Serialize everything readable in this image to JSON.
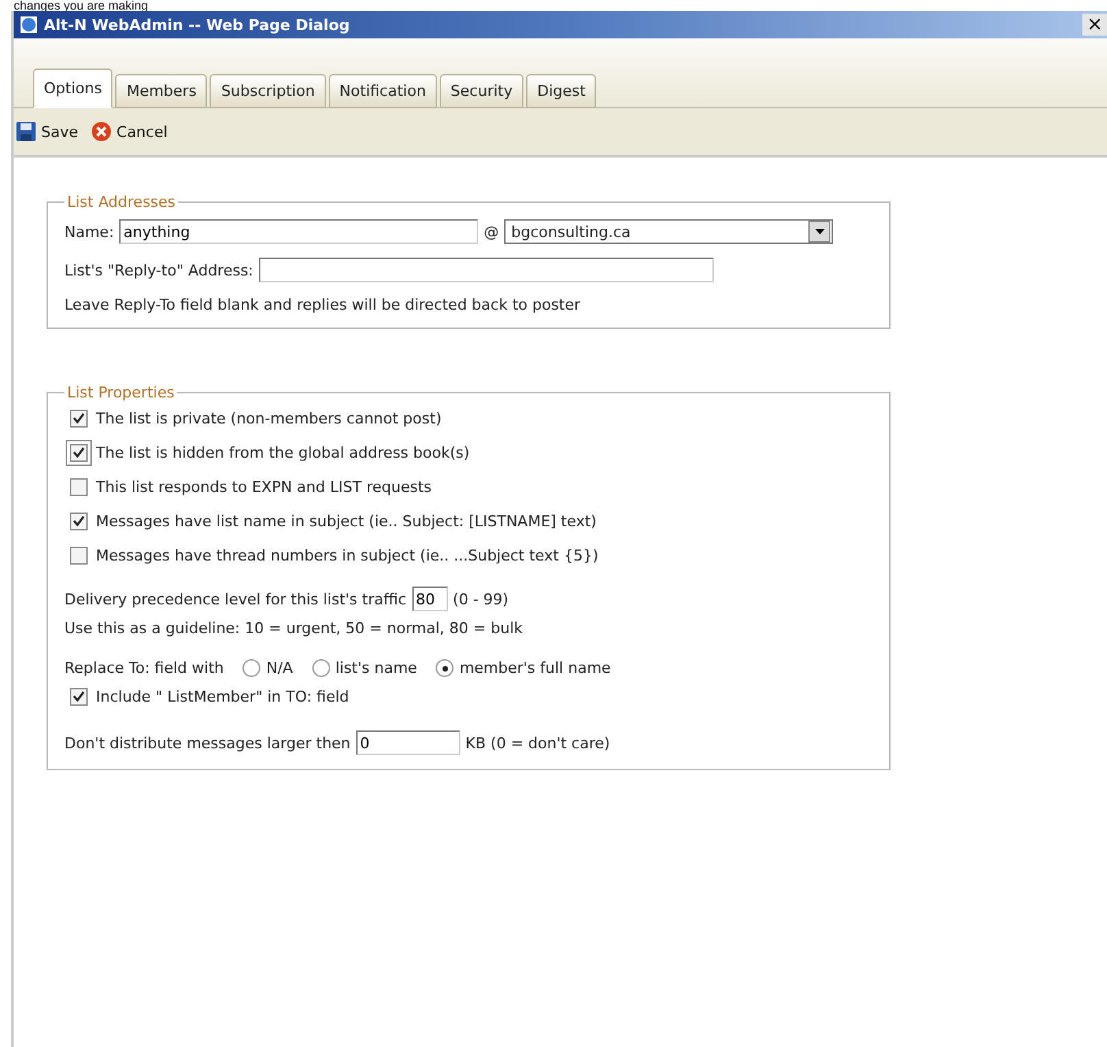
{
  "page_caption": "changes you are making",
  "window": {
    "title": "Alt-N WebAdmin -- Web Page Dialog",
    "close": "×"
  },
  "tabs": [
    {
      "label": "Options",
      "selected": true
    },
    {
      "label": "Members",
      "selected": false
    },
    {
      "label": "Subscription",
      "selected": false
    },
    {
      "label": "Notification",
      "selected": false
    },
    {
      "label": "Security",
      "selected": false
    },
    {
      "label": "Digest",
      "selected": false
    }
  ],
  "toolbar": [
    {
      "kind": "save",
      "label": "Save"
    },
    {
      "kind": "cancel",
      "label": "Cancel"
    }
  ],
  "list_addresses": {
    "legend": "List Addresses",
    "name_label": "Name:",
    "name_value": "anything",
    "at": "@",
    "domain": "bgconsulting.ca",
    "reply_to_label": "List's \"Reply-to\" Address:",
    "note": "Leave Reply-To field blank and replies will be directed back to poster"
  },
  "list_properties": {
    "legend": "List Properties",
    "options": [
      {
        "label": "The list is private (non-members cannot post)",
        "checked": true,
        "focused": false
      },
      {
        "label": "The list is hidden from the global address book(s)",
        "checked": true,
        "focused": true
      },
      {
        "label": "This list responds to EXPN and LIST requests",
        "checked": false,
        "focused": false
      },
      {
        "label": "Messages have list name in subject (ie.. Subject: [LISTNAME] text)",
        "checked": true,
        "focused": false
      },
      {
        "label": "Messages have thread numbers in subject (ie.. ...Subject text {5})",
        "checked": false,
        "focused": false
      }
    ],
    "precedence_label": "Delivery precedence level for this list's traffic",
    "precedence_value": "80",
    "precedence_range": "(0 - 99)",
    "guideline": "Use this as a guideline: 10 = urgent, 50 = normal, 80 = bulk",
    "replace_label": "Replace To: field with",
    "replace_options": [
      {
        "label": "N/A",
        "selected": false
      },
      {
        "label": "list's name",
        "selected": false
      },
      {
        "label": "member's full name",
        "selected": true
      }
    ],
    "include_member": {
      "label": "Include \" ListMember\" in TO: field",
      "checked": true
    },
    "size_label": "Don't distribute messages larger then",
    "size_value": "0",
    "size_unit": "KB (0 = don't care)"
  }
}
